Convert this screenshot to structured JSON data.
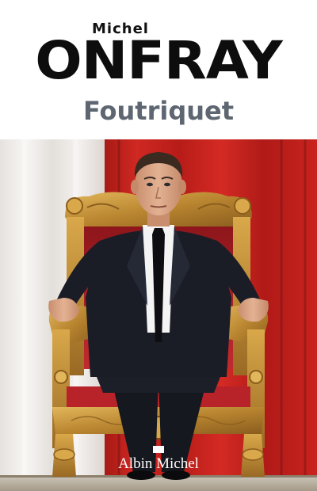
{
  "cover": {
    "author_first_name": "Michel",
    "author_last_name": "ONFRAY",
    "title": "Foutriquet",
    "publisher": "Albin Michel"
  },
  "colors": {
    "author_text": "#0d0d0d",
    "title_text": "#5d6671",
    "curtain_red": "#c4201c",
    "curtain_white": "#f1eeec",
    "throne_gold": "#c6953a",
    "throne_velvet": "#b8232a",
    "suit": "#1b1d26"
  }
}
